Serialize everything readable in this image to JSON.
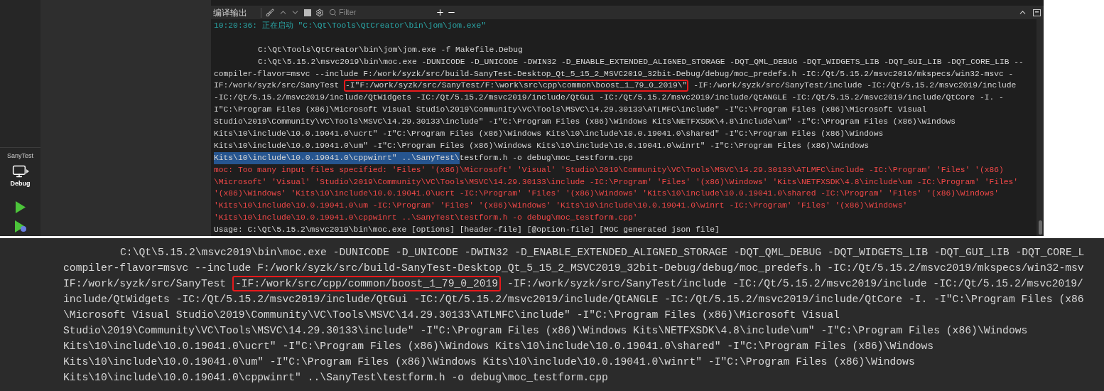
{
  "sidebar": {
    "project": "SanyTest",
    "build_config": "Debug"
  },
  "output_pane": {
    "title": "编译输出",
    "filter": {
      "placeholder": "Filter"
    },
    "lines": [
      {
        "kind": "status",
        "segments": [
          {
            "text": "10:20:36: 正在启动 \"C:\\Qt\\Tools\\QtCreator\\bin\\jom\\jom.exe\""
          }
        ]
      },
      {
        "kind": "blank"
      },
      {
        "kind": "command",
        "segments": [
          {
            "text": "C:\\Qt\\Tools\\QtCreator\\bin\\jom\\jom.exe -f Makefile.Debug"
          }
        ]
      },
      {
        "kind": "command",
        "segments": [
          {
            "text": "C:\\Qt\\5.15.2\\msvc2019\\bin\\moc.exe -DUNICODE -D_UNICODE -DWIN32 -D_ENABLE_EXTENDED_ALIGNED_STORAGE -DQT_QML_DEBUG -DQT_WIDGETS_LIB -DQT_GUI_LIB -DQT_CORE_LIB --"
          }
        ]
      },
      {
        "kind": "plain",
        "segments": [
          {
            "text": "compiler-flavor=msvc --include F:/work/syzk/src/build-SanyTest-Desktop_Qt_5_15_2_MSVC2019_32bit-Debug/debug/moc_predefs.h -IC:/Qt/5.15.2/msvc2019/mkspecs/win32-msvc -"
          }
        ]
      },
      {
        "kind": "plain",
        "segments": [
          {
            "text": "IF:/work/syzk/src/SanyTest "
          },
          {
            "text": "-I\"F:/work/syzk/src/SanyTest/F:\\work\\src\\cpp\\common\\boost_1_79_0_2019\\\"",
            "boxed": true
          },
          {
            "text": " -IF:/work/syzk/src/SanyTest/include -IC:/Qt/5.15.2/msvc2019/include"
          }
        ]
      },
      {
        "kind": "plain",
        "segments": [
          {
            "text": "-IC:/Qt/5.15.2/msvc2019/include/QtWidgets -IC:/Qt/5.15.2/msvc2019/include/QtGui -IC:/Qt/5.15.2/msvc2019/include/QtANGLE -IC:/Qt/5.15.2/msvc2019/include/QtCore -I. -"
          }
        ]
      },
      {
        "kind": "plain",
        "segments": [
          {
            "text": "I\"C:\\Program Files (x86)\\Microsoft Visual Studio\\2019\\Community\\VC\\Tools\\MSVC\\14.29.30133\\ATLMFC\\include\" -I\"C:\\Program Files (x86)\\Microsoft Visual"
          }
        ]
      },
      {
        "kind": "plain",
        "segments": [
          {
            "text": "Studio\\2019\\Community\\VC\\Tools\\MSVC\\14.29.30133\\include\" -I\"C:\\Program Files (x86)\\Windows Kits\\NETFXSDK\\4.8\\include\\um\" -I\"C:\\Program Files (x86)\\Windows"
          }
        ]
      },
      {
        "kind": "plain",
        "segments": [
          {
            "text": "Kits\\10\\include\\10.0.19041.0\\ucrt\" -I\"C:\\Program Files (x86)\\Windows Kits\\10\\include\\10.0.19041.0\\shared\" -I\"C:\\Program Files (x86)\\Windows"
          }
        ]
      },
      {
        "kind": "plain",
        "segments": [
          {
            "text": "Kits\\10\\include\\10.0.19041.0\\um\" -I\"C:\\Program Files (x86)\\Windows Kits\\10\\include\\10.0.19041.0\\winrt\" -I\"C:\\Program Files (x86)\\Windows"
          }
        ]
      },
      {
        "kind": "plain",
        "segments": [
          {
            "text": "Kits\\10\\include\\10.0.19041.0\\cppwinrt\" ..\\SanyTest\\",
            "selected": true
          },
          {
            "text": "testform.h -o debug\\moc_testform.cpp",
            "selected": false
          }
        ]
      },
      {
        "kind": "error",
        "segments": [
          {
            "text": "moc: Too many input files specified: 'Files' '(x86)\\Microsoft' 'Visual' 'Studio\\2019\\Community\\VC\\Tools\\MSVC\\14.29.30133\\ATLMFC\\include -IC:\\Program' 'Files' '(x86)"
          }
        ]
      },
      {
        "kind": "error",
        "segments": [
          {
            "text": "\\Microsoft' 'Visual' 'Studio\\2019\\Community\\VC\\Tools\\MSVC\\14.29.30133\\include -IC:\\Program' 'Files' '(x86)\\Windows' 'Kits\\NETFXSDK\\4.8\\include\\um -IC:\\Program' 'Files'"
          }
        ]
      },
      {
        "kind": "error",
        "segments": [
          {
            "text": "'(x86)\\Windows' 'Kits\\10\\include\\10.0.19041.0\\ucrt -IC:\\Program' 'Files' '(x86)\\Windows' 'Kits\\10\\include\\10.0.19041.0\\shared -IC:\\Program' 'Files' '(x86)\\Windows'"
          }
        ]
      },
      {
        "kind": "error",
        "segments": [
          {
            "text": "'Kits\\10\\include\\10.0.19041.0\\um -IC:\\Program' 'Files' '(x86)\\Windows' 'Kits\\10\\include\\10.0.19041.0\\winrt -IC:\\Program' 'Files' '(x86)\\Windows'"
          }
        ]
      },
      {
        "kind": "error",
        "segments": [
          {
            "text": "'Kits\\10\\include\\10.0.19041.0\\cppwinrt ..\\SanyTest\\testform.h -o debug\\moc_testform.cpp'"
          }
        ]
      },
      {
        "kind": "plain",
        "segments": [
          {
            "text": "Usage: C:\\Qt\\5.15.2\\msvc2019\\bin\\moc.exe [options] [header-file] [@option-file] [MOC generated json file]"
          }
        ]
      }
    ]
  },
  "console": {
    "lines": [
      {
        "kind": "command",
        "segments": [
          {
            "text": "C:\\Qt\\5.15.2\\msvc2019\\bin\\moc.exe -DUNICODE -D_UNICODE -DWIN32 -D_ENABLE_EXTENDED_ALIGNED_STORAGE -DQT_QML_DEBUG -DQT_WIDGETS_LIB -DQT_GUI_LIB -DQT_CORE_L"
          }
        ]
      },
      {
        "kind": "plain",
        "segments": [
          {
            "text": "compiler-flavor=msvc --include F:/work/syzk/src/build-SanyTest-Desktop_Qt_5_15_2_MSVC2019_32bit-Debug/debug/moc_predefs.h -IC:/Qt/5.15.2/msvc2019/mkspecs/win32-msv"
          }
        ]
      },
      {
        "kind": "plain",
        "segments": [
          {
            "text": "IF:/work/syzk/src/SanyTest "
          },
          {
            "text": "-IF:/work/src/cpp/common/boost_1_79_0_2019",
            "boxed": true
          },
          {
            "text": " -IF:/work/syzk/src/SanyTest/include -IC:/Qt/5.15.2/msvc2019/include -IC:/Qt/5.15.2/msvc2019/"
          }
        ]
      },
      {
        "kind": "plain",
        "segments": [
          {
            "text": "include/QtWidgets -IC:/Qt/5.15.2/msvc2019/include/QtGui -IC:/Qt/5.15.2/msvc2019/include/QtANGLE -IC:/Qt/5.15.2/msvc2019/include/QtCore -I. -I\"C:\\Program Files (x86"
          }
        ]
      },
      {
        "kind": "plain",
        "segments": [
          {
            "text": "\\Microsoft Visual Studio\\2019\\Community\\VC\\Tools\\MSVC\\14.29.30133\\ATLMFC\\include\" -I\"C:\\Program Files (x86)\\Microsoft Visual"
          }
        ]
      },
      {
        "kind": "plain",
        "segments": [
          {
            "text": "Studio\\2019\\Community\\VC\\Tools\\MSVC\\14.29.30133\\include\" -I\"C:\\Program Files (x86)\\Windows Kits\\NETFXSDK\\4.8\\include\\um\" -I\"C:\\Program Files (x86)\\Windows"
          }
        ]
      },
      {
        "kind": "plain",
        "segments": [
          {
            "text": "Kits\\10\\include\\10.0.19041.0\\ucrt\" -I\"C:\\Program Files (x86)\\Windows Kits\\10\\include\\10.0.19041.0\\shared\" -I\"C:\\Program Files (x86)\\Windows"
          }
        ]
      },
      {
        "kind": "plain",
        "segments": [
          {
            "text": "Kits\\10\\include\\10.0.19041.0\\um\" -I\"C:\\Program Files (x86)\\Windows Kits\\10\\include\\10.0.19041.0\\winrt\" -I\"C:\\Program Files (x86)\\Windows"
          }
        ]
      },
      {
        "kind": "plain",
        "segments": [
          {
            "text": "Kits\\10\\include\\10.0.19041.0\\cppwinrt\" ..\\SanyTest\\testform.h -o debug\\moc_testform.cpp"
          }
        ]
      }
    ]
  }
}
